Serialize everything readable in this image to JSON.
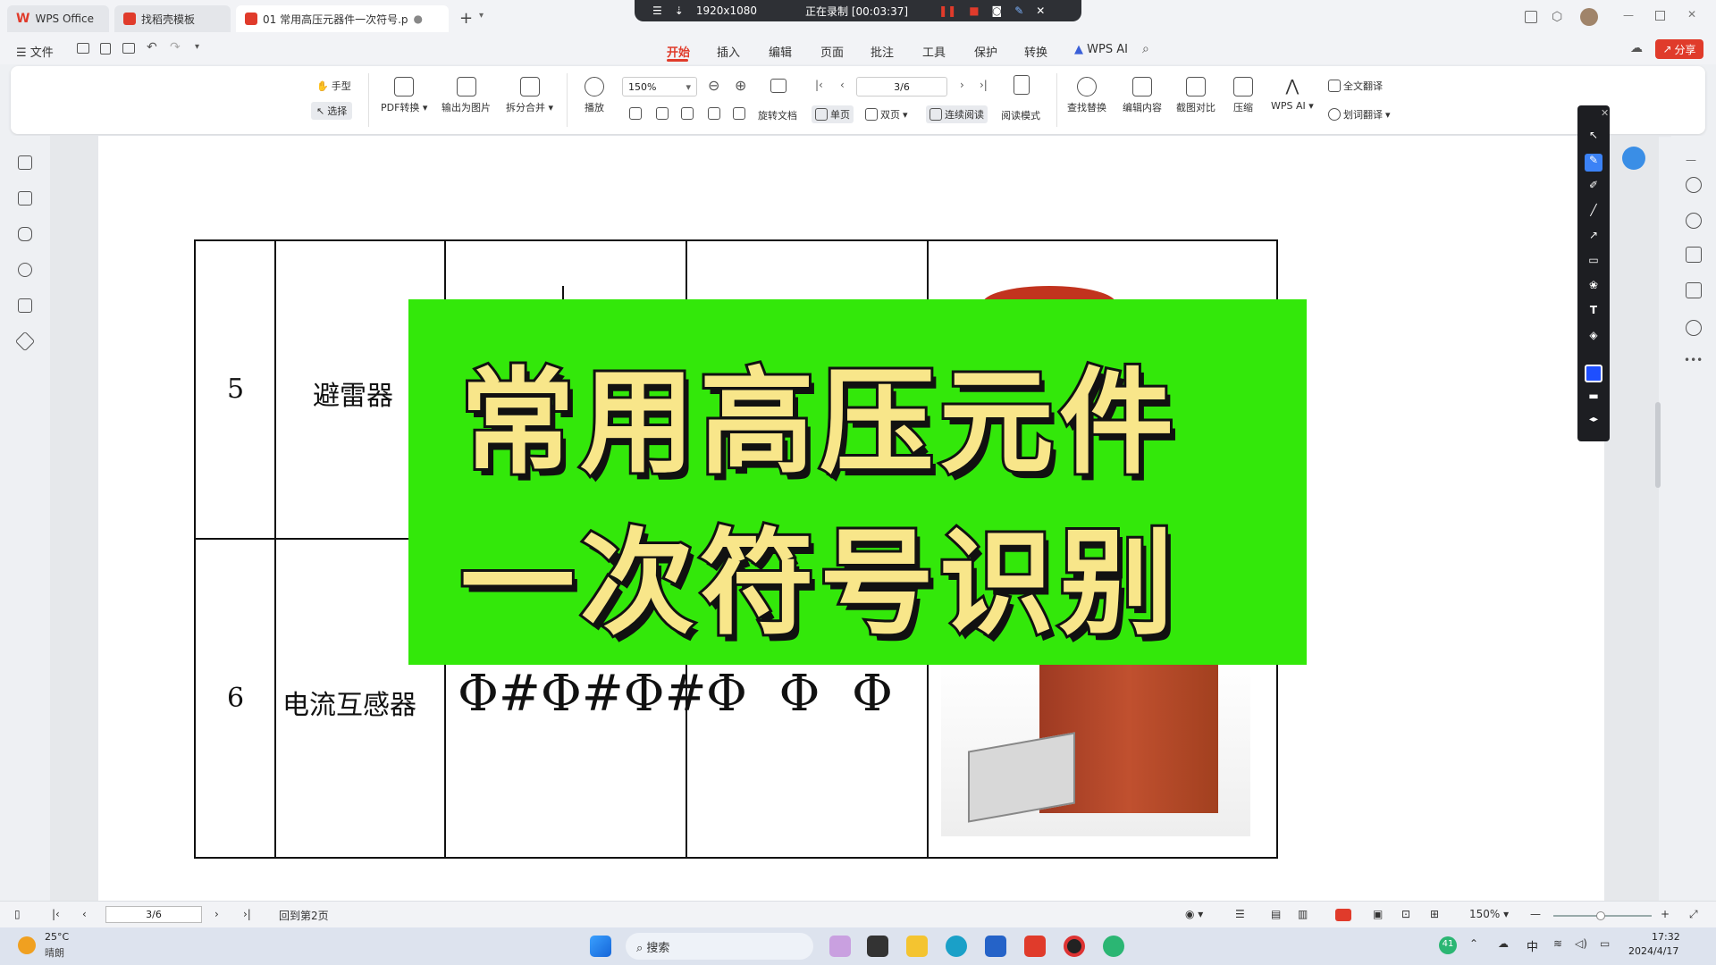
{
  "tabs": [
    {
      "label": "WPS Office"
    },
    {
      "label": "找稻壳模板"
    },
    {
      "label": "01 常用高压元器件一次符号.p"
    }
  ],
  "recording": {
    "resolution": "1920x1080",
    "status": "正在录制 [00:03:37]"
  },
  "menu": {
    "file": "文件",
    "items": [
      "开始",
      "插入",
      "编辑",
      "页面",
      "批注",
      "工具",
      "保护",
      "转换",
      "WPS AI"
    ],
    "share": "分享"
  },
  "ribbon": {
    "hand": "手型",
    "select": "选择",
    "pdf_convert": "PDF转换",
    "export_image": "输出为图片",
    "split_merge": "拆分合并",
    "play": "播放",
    "zoom": "150%",
    "page": "3/6",
    "rotate": "旋转文档",
    "single": "单页",
    "double": "双页",
    "continuous": "连续阅读",
    "reading_mode": "阅读模式",
    "find_replace": "查找替换",
    "edit_content": "编辑内容",
    "compare": "截图对比",
    "compress": "压缩",
    "wps_ai": "WPS AI",
    "full_translate": "全文翻译",
    "word_translate": "划词翻译"
  },
  "document": {
    "rows": [
      {
        "num": "5",
        "name": "避雷器"
      },
      {
        "num": "6",
        "name": "电流互感器"
      }
    ],
    "ct_symbol_1": "Φ#Φ#Φ#",
    "ct_symbol_2": "Φ  Φ  Φ",
    "banner_line1": "常用高压元件",
    "banner_line2": "一次符号识别"
  },
  "status": {
    "page": "3/6",
    "back": "回到第2页",
    "zoom": "150%"
  },
  "taskbar": {
    "temp": "25°C",
    "weather": "晴朗",
    "search": "搜索",
    "lang": "中",
    "time": "17:32",
    "date": "2024/4/17",
    "badge": "41"
  },
  "colors": {
    "accent": "#e03b2b",
    "banner": "#33e80a",
    "banner_text": "#f8e68a"
  }
}
